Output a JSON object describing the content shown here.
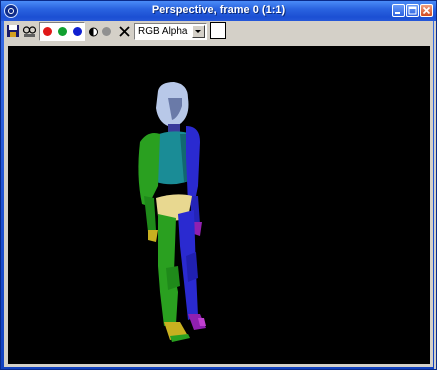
{
  "window": {
    "title": "Perspective, frame 0 (1:1)"
  },
  "toolbar": {
    "icons": [
      "save-icon",
      "clone-icon",
      "red-channel-icon",
      "green-channel-icon",
      "blue-channel-icon",
      "mono-icon",
      "alpha-channel-icon",
      "clear-icon"
    ],
    "channel_select_value": "RGB Alpha"
  },
  "colors": {
    "titlebar": "#2a63e0",
    "red_channel": "#e01818",
    "green_channel": "#10a030",
    "blue_channel": "#1020d0",
    "viewport_bg": "#000000",
    "figure_head": "#b8c8e8",
    "figure_torso": "#1a8c96",
    "figure_green": "#2aa020",
    "figure_blue": "#2a2ad0",
    "figure_pelvis": "#e8d890",
    "figure_feet": "#c8b020",
    "figure_purple": "#9020b0"
  }
}
